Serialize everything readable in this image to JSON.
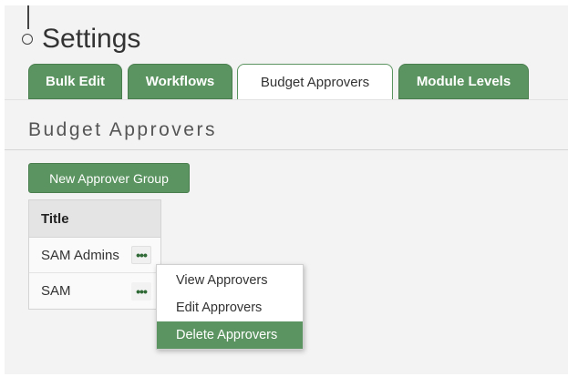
{
  "page": {
    "title": "Settings"
  },
  "tabs": [
    {
      "label": "Bulk Edit",
      "active": false
    },
    {
      "label": "Workflows",
      "active": false
    },
    {
      "label": "Budget Approvers",
      "active": true
    },
    {
      "label": "Module Levels",
      "active": false
    }
  ],
  "section": {
    "title": "Budget Approvers",
    "new_group_label": "New Approver Group"
  },
  "table": {
    "header": "Title",
    "rows": [
      {
        "title": "SAM Admins",
        "action": "•••"
      },
      {
        "title": "SAM",
        "action": "•••"
      }
    ]
  },
  "context_menu": {
    "items": [
      {
        "label": "View Approvers",
        "highlighted": false
      },
      {
        "label": "Edit Approvers",
        "highlighted": false
      },
      {
        "label": "Delete Approvers",
        "highlighted": true
      }
    ]
  },
  "colors": {
    "accent": "#5b9460",
    "accent_border": "#4a7e4f",
    "background": "#f3f3f3"
  }
}
